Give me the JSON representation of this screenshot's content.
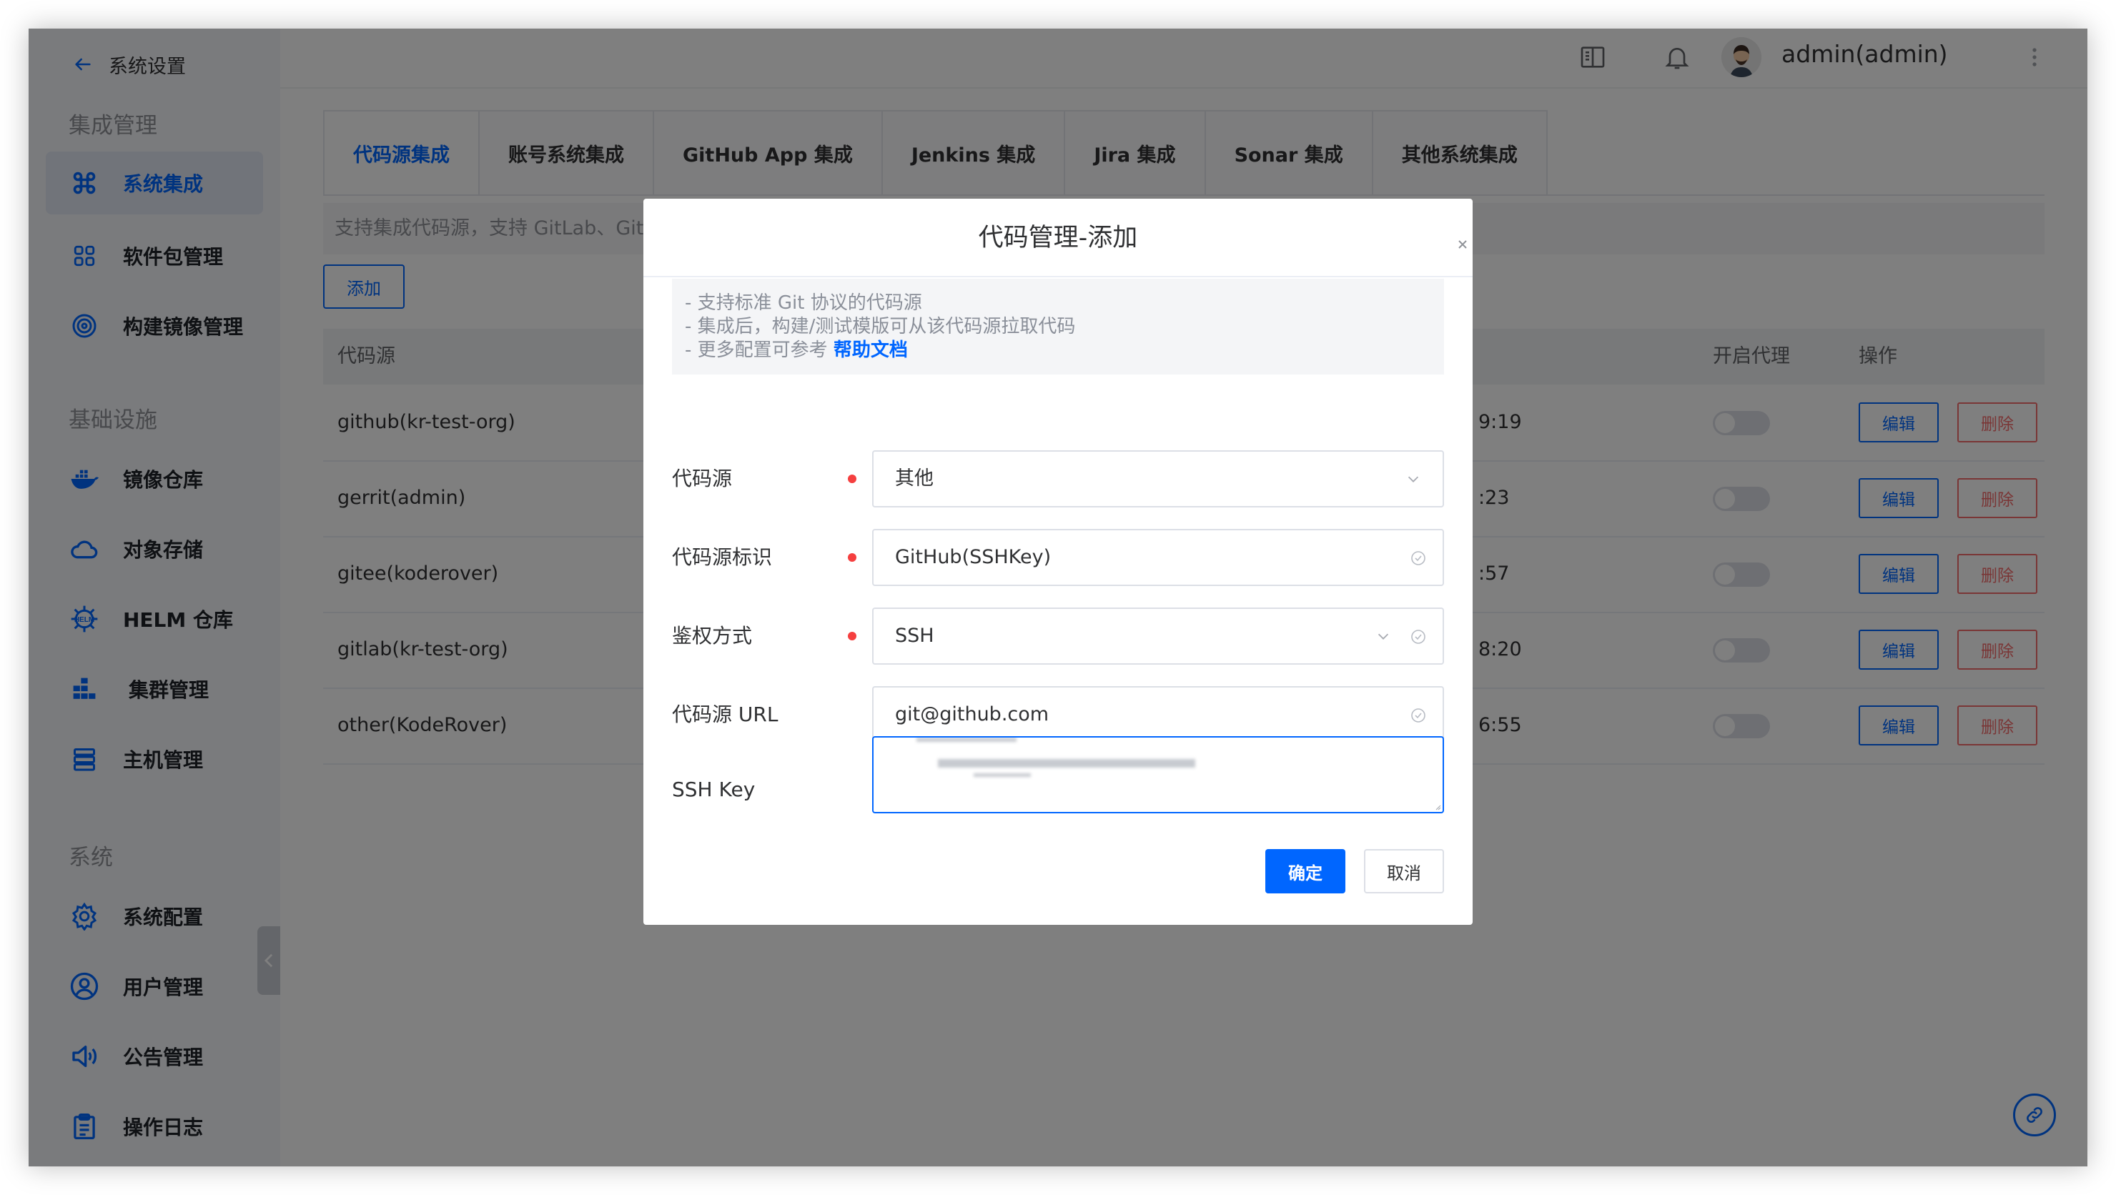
{
  "sidebar": {
    "back_label": "系统设置",
    "sections": [
      {
        "title": "集成管理"
      },
      {
        "title": "基础设施"
      },
      {
        "title": "系统"
      }
    ],
    "items": [
      {
        "label": "系统集成",
        "icon": "command-icon",
        "active": true
      },
      {
        "label": "软件包管理",
        "icon": "grid-icon"
      },
      {
        "label": "构建镜像管理",
        "icon": "target-icon"
      },
      {
        "label": "镜像仓库",
        "icon": "docker-icon"
      },
      {
        "label": "对象存储",
        "icon": "cloud-icon"
      },
      {
        "label": "HELM 仓库",
        "icon": "helm-icon"
      },
      {
        "label": "集群管理",
        "icon": "cluster-icon"
      },
      {
        "label": "主机管理",
        "icon": "server-icon"
      },
      {
        "label": "系统配置",
        "icon": "settings-icon"
      },
      {
        "label": "用户管理",
        "icon": "user-icon"
      },
      {
        "label": "公告管理",
        "icon": "speaker-icon"
      },
      {
        "label": "操作日志",
        "icon": "clipboard-icon"
      }
    ]
  },
  "header": {
    "username": "admin(admin)",
    "icons": [
      "book-icon",
      "bell-icon",
      "more-vertical-icon"
    ]
  },
  "tabs": [
    "代码源集成",
    "账号系统集成",
    "GitHub App 集成",
    "Jenkins 集成",
    "Jira 集成",
    "Sonar 集成",
    "其他系统集成"
  ],
  "description": "支持集成代码源，支持 GitLab、Git",
  "add_button": "添加",
  "table": {
    "headers": [
      "代码源",
      "开启代理",
      "操作"
    ],
    "rows": [
      {
        "name": "github(kr-test-org)",
        "time": "9:19"
      },
      {
        "name": "gerrit(admin)",
        "time": ":23"
      },
      {
        "name": "gitee(koderover)",
        "time": ":57"
      },
      {
        "name": "gitlab(kr-test-org)",
        "time": "8:20"
      },
      {
        "name": "other(KodeRover)",
        "time": "6:55"
      }
    ],
    "edit_label": "编辑",
    "delete_label": "删除"
  },
  "dialog": {
    "title": "代码管理-添加",
    "info_lines": [
      "- 支持标准 Git 协议的代码源",
      "- 集成后，构建/测试模版可从该代码源拉取代码",
      "- 更多配置可参考 "
    ],
    "help_link": "帮助文档",
    "fields": [
      {
        "label": "代码源",
        "value": "其他",
        "required": true
      },
      {
        "label": "代码源标识",
        "value": "GitHub(SSHKey)",
        "required": true
      },
      {
        "label": "鉴权方式",
        "value": "SSH",
        "required": true
      },
      {
        "label": "代码源 URL",
        "value": "git@github.com",
        "required": false
      },
      {
        "label": "SSH Key",
        "value": "",
        "required": false
      }
    ],
    "confirm": "确定",
    "cancel": "取消"
  },
  "colors": {
    "primary": "#0066ff",
    "danger": "#f56c6c",
    "required": "#f53f3f"
  }
}
